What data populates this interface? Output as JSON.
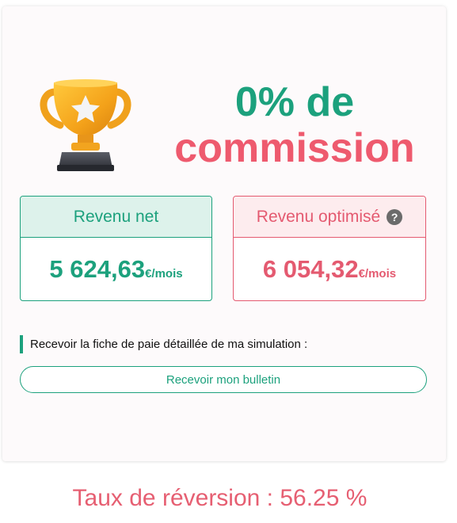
{
  "headline": {
    "line1": "0% de",
    "line2": "commission"
  },
  "net": {
    "label": "Revenu net",
    "amount": "5 624,63",
    "unit": "€/mois"
  },
  "optimized": {
    "label": "Revenu optimisé",
    "help_icon": "question-circle-icon",
    "amount": "6 054,32",
    "unit": "€/mois"
  },
  "payslip": {
    "prompt": "Recevoir la fiche de paie détaillée de ma simulation :",
    "button_label": "Recevoir mon bulletin"
  },
  "footer": {
    "reversion": "Taux de réversion : 56.25 %"
  },
  "colors": {
    "green": "#1ca17d",
    "pink": "#e45a70"
  },
  "icons": {
    "trophy": "trophy-icon"
  }
}
